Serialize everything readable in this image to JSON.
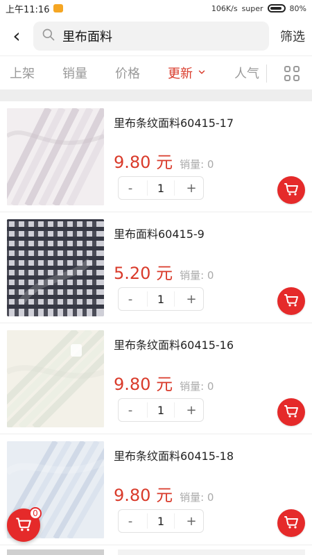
{
  "status_bar": {
    "time": "上午11:16",
    "network_speed": "106K/s",
    "carrier": "super",
    "battery_percent": "80%"
  },
  "top_bar": {
    "search_text": "里布面料",
    "filter_label": "筛选"
  },
  "sort_bar": {
    "items": [
      {
        "label": "上架"
      },
      {
        "label": "销量"
      },
      {
        "label": "价格"
      },
      {
        "label": "更新",
        "active": true
      },
      {
        "label": "人气"
      }
    ]
  },
  "products": [
    {
      "title": "里布条纹面料60415-17",
      "price": "9.80 元",
      "sales_label": "销量:",
      "sales_value": "0",
      "qty": "1"
    },
    {
      "title": "里布面料60415-9",
      "price": "5.20 元",
      "sales_label": "销量:",
      "sales_value": "0",
      "qty": "1"
    },
    {
      "title": "里布条纹面料60415-16",
      "price": "9.80 元",
      "sales_label": "销量:",
      "sales_value": "0",
      "qty": "1"
    },
    {
      "title": "里布条纹面料60415-18",
      "price": "9.80 元",
      "sales_label": "销量:",
      "sales_value": "0",
      "qty": "1"
    }
  ],
  "floating_cart": {
    "count": "0"
  },
  "icons": {
    "back": "chevron-left-icon",
    "search": "search-icon",
    "sort_dropdown": "chevron-down-icon",
    "view_toggle": "grid-icon",
    "cart": "cart-icon"
  },
  "colors": {
    "accent_red": "#e52a2a",
    "price_red": "#d93a2a"
  }
}
